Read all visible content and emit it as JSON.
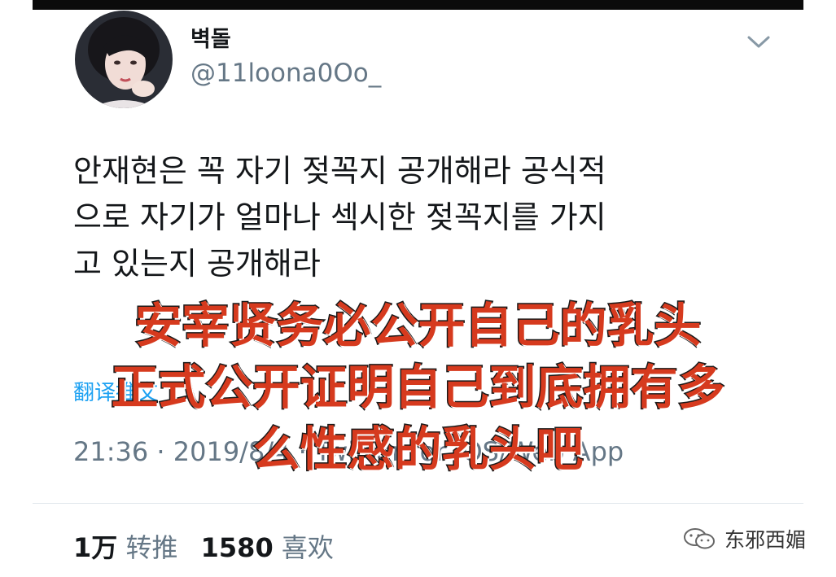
{
  "tweet": {
    "display_name": "벽돌",
    "handle": "@11loona0Oo_",
    "text": "안재현은 꼭 자기 젖꼭지 공개해라 공식적\n으로 자기가 얼마나 섹시한 젖꼭지를 가지\n고 있는지 공개해라",
    "translate_label": "翻译推文",
    "timestamp": "21:36 · 2019/8/4 · Twitter for iOS/Web App"
  },
  "stats": {
    "retweets_count": "1万",
    "retweets_label": "转推",
    "likes_count": "1580",
    "likes_label": "喜欢"
  },
  "overlay": {
    "lines": [
      "安宰贤务必公开自己的乳头",
      "正式公开证明自己到底拥有多",
      "么性感的乳头吧"
    ],
    "fill_color": "#d63a1e",
    "outline_color": "#1a1a1a"
  },
  "watermark": {
    "text": "东邪西媚",
    "icon": "wechat-icon"
  },
  "colors": {
    "handle": "#657786",
    "link": "#1da1f2",
    "divider": "#e1e8ed"
  }
}
